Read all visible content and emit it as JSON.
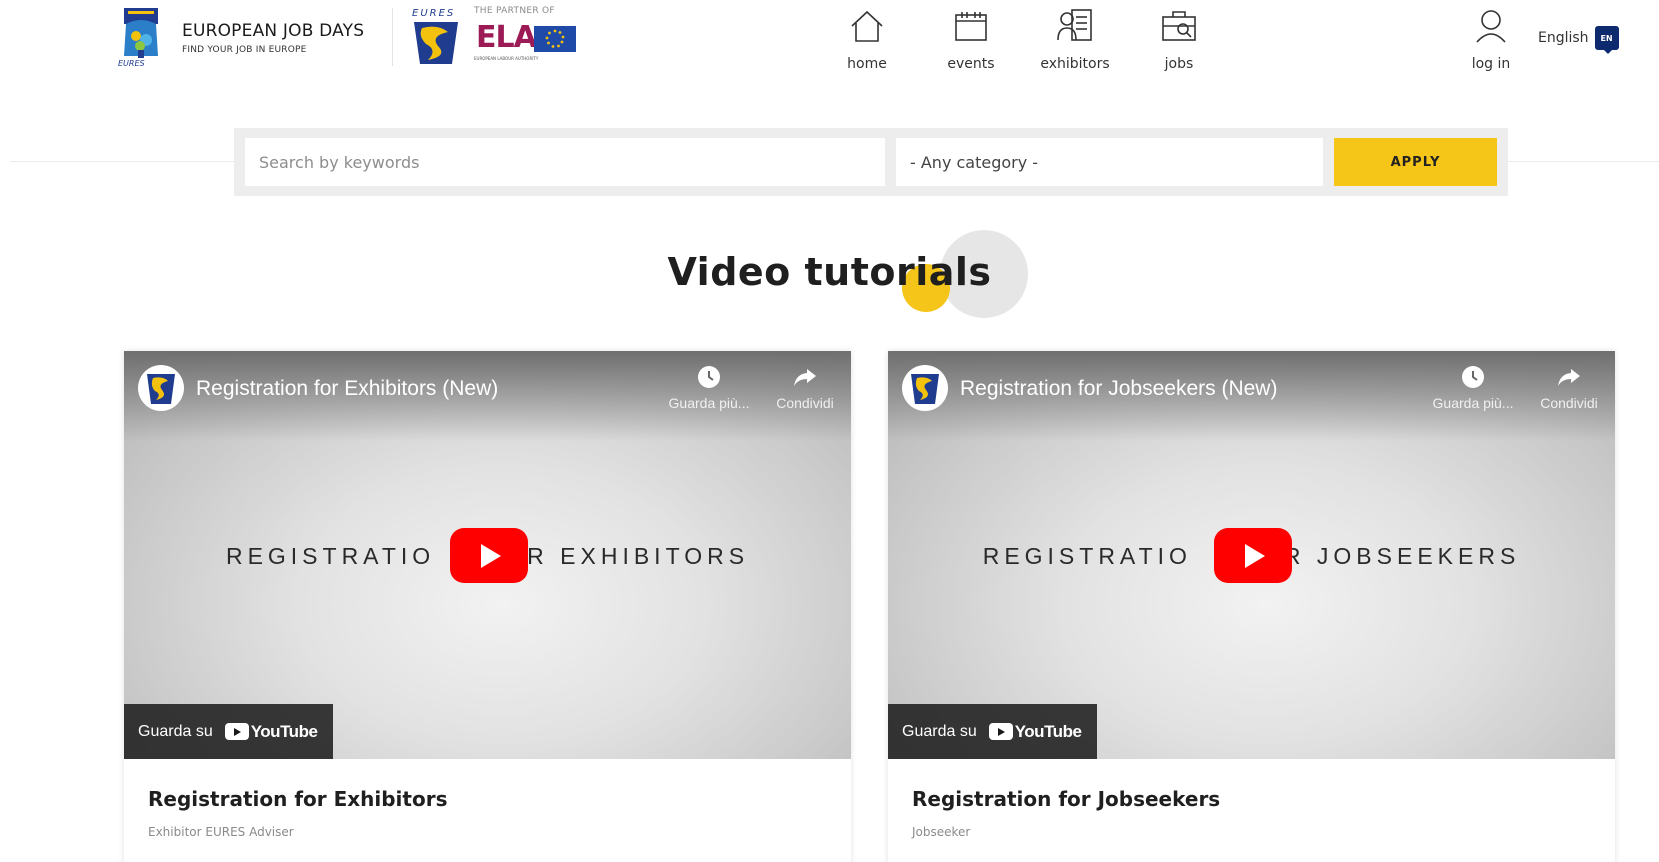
{
  "header": {
    "brand_title": "EUROPEAN JOB DAYS",
    "brand_subtitle": "FIND YOUR JOB IN EUROPE",
    "partner_label": "THE PARTNER OF",
    "partner_logo_text": "ELA",
    "partner_logo_caption": "EUROPEAN LABOUR AUTHORITY",
    "nav": [
      {
        "label": "home",
        "icon": "home-icon"
      },
      {
        "label": "events",
        "icon": "calendar-icon"
      },
      {
        "label": "exhibitors",
        "icon": "exhibitor-icon"
      },
      {
        "label": "jobs",
        "icon": "briefcase-icon"
      }
    ],
    "login_label": "log in",
    "language_label": "English",
    "language_code": "EN"
  },
  "search": {
    "placeholder": "Search by keywords",
    "value": "",
    "category_selected": "- Any category -",
    "apply_label": "APPLY"
  },
  "section": {
    "title": "Video tutorials"
  },
  "videos": [
    {
      "player_title": "Registration for Exhibitors (New)",
      "watch_later_label": "Guarda più...",
      "share_label": "Condividi",
      "thumbnail_text_left": "REGISTRATIO",
      "thumbnail_text_right": "R EXHIBITORS",
      "watch_on_label": "Guarda su",
      "youtube_label": "YouTube",
      "card_title": "Registration for Exhibitors",
      "card_meta": "Exhibitor EURES Adviser"
    },
    {
      "player_title": "Registration for Jobseekers (New)",
      "watch_later_label": "Guarda più...",
      "share_label": "Condividi",
      "thumbnail_text_left": "REGISTRATIO",
      "thumbnail_text_right": "R JOBSEEKERS",
      "watch_on_label": "Guarda su",
      "youtube_label": "YouTube",
      "card_title": "Registration for Jobseekers",
      "card_meta": "Jobseeker"
    }
  ],
  "colors": {
    "accent_yellow": "#f5c518",
    "youtube_red": "#ff0000",
    "ela_purple": "#9c1a56",
    "eu_blue": "#1f4aa8",
    "lang_badge": "#0d2a6e"
  }
}
